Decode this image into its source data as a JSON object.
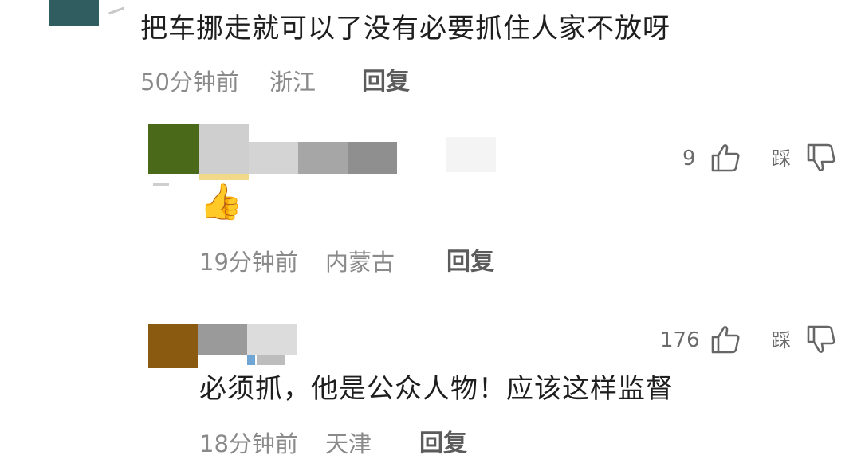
{
  "comments": [
    {
      "text": "把车挪走就可以了没有必要抓住人家不放呀",
      "time": "50分钟前",
      "location": "浙江",
      "reply_label": "回复"
    },
    {
      "text": "👍",
      "time": "19分钟前",
      "location": "内蒙古",
      "reply_label": "回复",
      "like_count": "9",
      "dislike_label": "踩"
    },
    {
      "text": "必须抓，他是公众人物！应该这样监督",
      "time": "18分钟前",
      "location": "天津",
      "reply_label": "回复",
      "like_count": "176",
      "dislike_label": "踩"
    }
  ],
  "colors": {
    "avatar_1": "#2f5d60",
    "avatar_2": "#4a6a1a",
    "avatar_3": "#8a5a10",
    "meta_text": "#8a8a8a",
    "reply_text": "#5c5c5c"
  },
  "icons": [
    "thumbs-up-icon",
    "thumbs-down-icon"
  ]
}
